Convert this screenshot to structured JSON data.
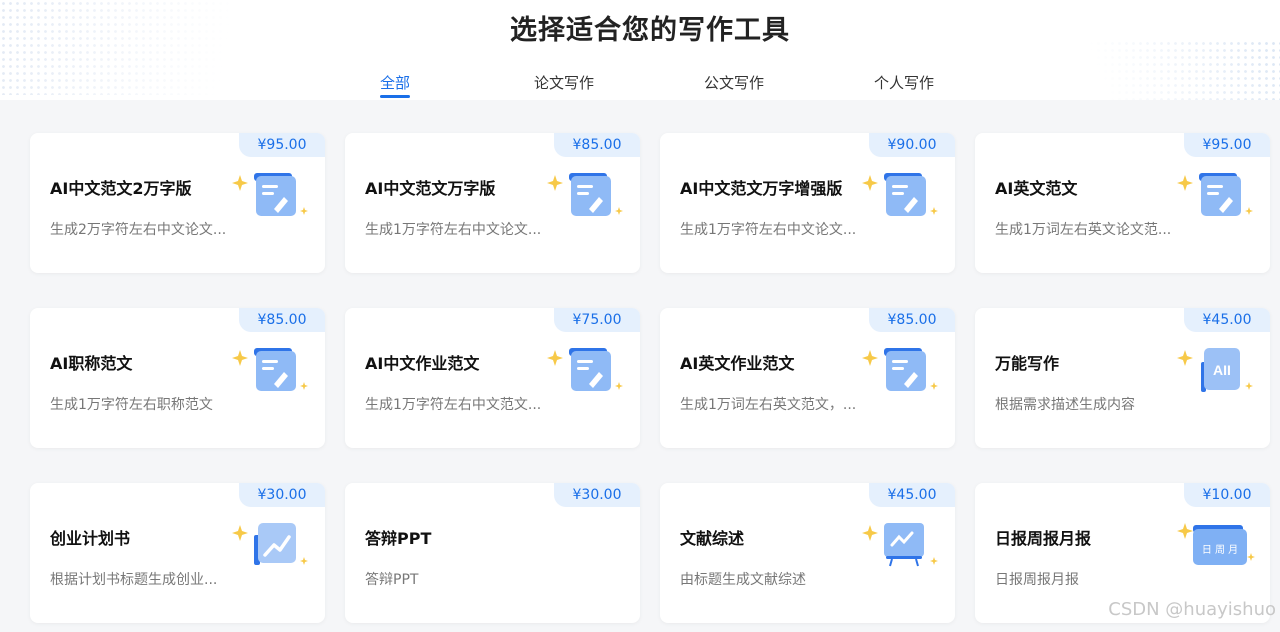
{
  "header": {
    "title": "选择适合您的写作工具"
  },
  "tabs": [
    {
      "label": "全部",
      "active": true
    },
    {
      "label": "论文写作",
      "active": false
    },
    {
      "label": "公文写作",
      "active": false
    },
    {
      "label": "个人写作",
      "active": false
    }
  ],
  "cards": [
    {
      "price": "¥95.00",
      "title": "AI中文范文2万字版",
      "desc": "生成2万字符左右中文论文...",
      "icon": "document-pen-icon"
    },
    {
      "price": "¥85.00",
      "title": "AI中文范文万字版",
      "desc": "生成1万字符左右中文论文...",
      "icon": "document-pen-icon"
    },
    {
      "price": "¥90.00",
      "title": "AI中文范文万字增强版",
      "desc": "生成1万字符左右中文论文...",
      "icon": "document-pen-icon"
    },
    {
      "price": "¥95.00",
      "title": "AI英文范文",
      "desc": "生成1万词左右英文论文范...",
      "icon": "document-pen-icon"
    },
    {
      "price": "¥85.00",
      "title": "AI职称范文",
      "desc": "生成1万字符左右职称范文",
      "icon": "document-pen-icon"
    },
    {
      "price": "¥75.00",
      "title": "AI中文作业范文",
      "desc": "生成1万字符左右中文范文...",
      "icon": "document-pen-icon"
    },
    {
      "price": "¥85.00",
      "title": "AI英文作业范文",
      "desc": "生成1万词左右英文范文，...",
      "icon": "document-pen-icon"
    },
    {
      "price": "¥45.00",
      "title": "万能写作",
      "desc": "根据需求描述生成内容",
      "icon": "ai-book-icon",
      "icon_text": "AII"
    },
    {
      "price": "¥30.00",
      "title": "创业计划书",
      "desc": "根据计划书标题生成创业...",
      "icon": "chart-up-icon"
    },
    {
      "price": "¥30.00",
      "title": "答辩PPT",
      "desc": "答辩PPT",
      "icon": "none"
    },
    {
      "price": "¥45.00",
      "title": "文献综述",
      "desc": "由标题生成文献综述",
      "icon": "presentation-board-icon"
    },
    {
      "price": "¥10.00",
      "title": "日报周报月报",
      "desc": "日报周报月报",
      "icon": "calendar-icon",
      "icon_text": "日 周 月"
    }
  ],
  "watermark": "CSDN @huayishuo",
  "colors": {
    "accent": "#1a6fe8",
    "price_bg": "#e5f0fd",
    "sparkle": "#f7c948"
  }
}
